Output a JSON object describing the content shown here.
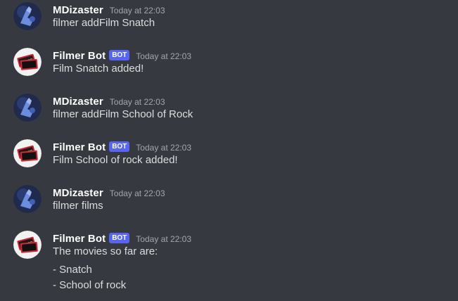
{
  "messages": [
    {
      "author": "MDizaster",
      "timestamp": "Today at 22:03",
      "lines": [
        "filmer addFilm Snatch"
      ]
    },
    {
      "author": "Filmer Bot",
      "bot_tag": "BOT",
      "timestamp": "Today at 22:03",
      "lines": [
        "Film Snatch added!"
      ]
    },
    {
      "author": "MDizaster",
      "timestamp": "Today at 22:03",
      "lines": [
        "filmer addFilm School of Rock"
      ]
    },
    {
      "author": "Filmer Bot",
      "bot_tag": "BOT",
      "timestamp": "Today at 22:03",
      "lines": [
        "Film School of rock added!"
      ]
    },
    {
      "author": "MDizaster",
      "timestamp": "Today at 22:03",
      "lines": [
        "filmer films"
      ]
    },
    {
      "author": "Filmer Bot",
      "bot_tag": "BOT",
      "timestamp": "Today at 22:03",
      "lines": [
        "The movies so far are:",
        "- Snatch",
        "- School of rock"
      ]
    }
  ],
  "avatars": {
    "user_icon": "user-avatar-blue-figure",
    "bot_icon": "film-tickets-icon",
    "bot_ticket_text": "FILMER"
  },
  "colors": {
    "background": "#36393f",
    "username": "#ffffff",
    "message_text": "#dcddde",
    "timestamp": "#a3a6aa",
    "bot_tag": "#5865f2"
  }
}
